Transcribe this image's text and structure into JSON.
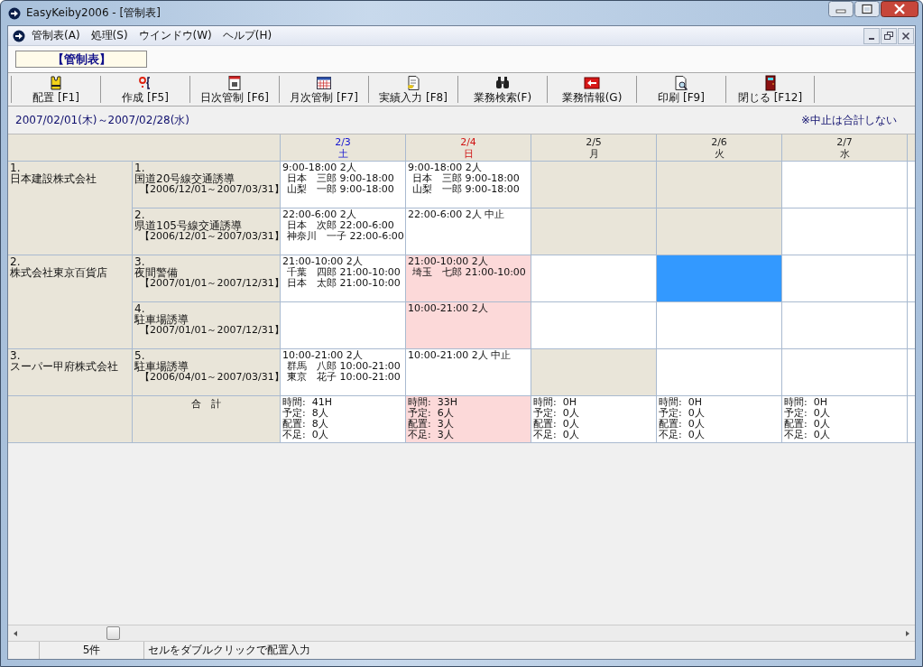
{
  "window": {
    "title": "EasyKeiby2006 - [管制表]"
  },
  "menu": [
    {
      "label": "管制表(A)"
    },
    {
      "label": "処理(S)"
    },
    {
      "label": "ウインドウ(W)"
    },
    {
      "label": "ヘルプ(H)"
    }
  ],
  "form_label": "【管制表】",
  "toolbar": [
    {
      "label": "配置 [F1]"
    },
    {
      "label": "作成 [F5]"
    },
    {
      "label": "日次管制 [F6]"
    },
    {
      "label": "月次管制 [F7]"
    },
    {
      "label": "実績入力 [F8]"
    },
    {
      "label": "業務検索(F)"
    },
    {
      "label": "業務情報(G)"
    },
    {
      "label": "印刷 [F9]"
    },
    {
      "label": "閉じる [F12]"
    }
  ],
  "period": "2007/02/01(木)～2007/02/28(水)",
  "note": "※中止は合計しない",
  "days": [
    {
      "date": "2/3",
      "weekday": "土",
      "kind": "saturday"
    },
    {
      "date": "2/4",
      "weekday": "日",
      "kind": "sunday"
    },
    {
      "date": "2/5",
      "weekday": "月",
      "kind": "weekday"
    },
    {
      "date": "2/6",
      "weekday": "火",
      "kind": "weekday"
    },
    {
      "date": "2/7",
      "weekday": "水",
      "kind": "weekday"
    }
  ],
  "companies": [
    {
      "number": "1.",
      "name": "日本建設株式会社",
      "jobs": [
        {
          "number": "1.",
          "name": "国道20号線交通誘導",
          "period": "【2006/12/01～2007/03/31】",
          "cells": [
            {
              "kind": "open",
              "selected": false,
              "shift": "9:00-18:00 2人",
              "staff": [
                "日本　三郎 9:00-18:00",
                "山梨　一郎 9:00-18:00"
              ]
            },
            {
              "kind": "open",
              "selected": false,
              "shift": "9:00-18:00 2人",
              "staff": [
                "日本　三郎 9:00-18:00",
                "山梨　一郎 9:00-18:00"
              ]
            },
            {
              "kind": "closed",
              "selected": false
            },
            {
              "kind": "closed",
              "selected": false
            },
            {
              "kind": "open",
              "selected": false
            }
          ]
        },
        {
          "number": "2.",
          "name": "県道105号線交通誘導",
          "period": "【2006/12/01～2007/03/31】",
          "cells": [
            {
              "kind": "open",
              "selected": false,
              "shift": "22:00-6:00 2人",
              "staff": [
                "日本　次郎 22:00-6:00",
                "神奈川　一子 22:00-6:00"
              ]
            },
            {
              "kind": "open",
              "selected": false,
              "shift": "22:00-6:00 2人 中止"
            },
            {
              "kind": "closed",
              "selected": false
            },
            {
              "kind": "closed",
              "selected": false
            },
            {
              "kind": "open",
              "selected": false
            }
          ]
        }
      ]
    },
    {
      "number": "2.",
      "name": "株式会社東京百貨店",
      "jobs": [
        {
          "number": "3.",
          "name": "夜間警備",
          "period": "【2007/01/01～2007/12/31】",
          "cells": [
            {
              "kind": "open",
              "selected": false,
              "shift": "21:00-10:00 2人",
              "staff": [
                "千葉　四郎 21:00-10:00",
                "日本　太郎 21:00-10:00"
              ]
            },
            {
              "kind": "short",
              "selected": false,
              "shift": "21:00-10:00 2人",
              "staff": [
                "埼玉　七郎 21:00-10:00"
              ]
            },
            {
              "kind": "open",
              "selected": false
            },
            {
              "kind": "open",
              "selected": true
            },
            {
              "kind": "open",
              "selected": false
            }
          ]
        },
        {
          "number": "4.",
          "name": "駐車場誘導",
          "period": "【2007/01/01～2007/12/31】",
          "cells": [
            {
              "kind": "open",
              "selected": false
            },
            {
              "kind": "short",
              "selected": false,
              "shift": "10:00-21:00 2人"
            },
            {
              "kind": "open",
              "selected": false
            },
            {
              "kind": "open",
              "selected": false
            },
            {
              "kind": "open",
              "selected": false
            }
          ]
        }
      ]
    },
    {
      "number": "3.",
      "name": "スーパー甲府株式会社",
      "jobs": [
        {
          "number": "5.",
          "name": "駐車場誘導",
          "period": "【2006/04/01～2007/03/31】",
          "cells": [
            {
              "kind": "open",
              "selected": false,
              "shift": "10:00-21:00 2人",
              "staff": [
                "群馬　八郎 10:00-21:00",
                "東京　花子 10:00-21:00"
              ]
            },
            {
              "kind": "open",
              "selected": false,
              "shift": "10:00-21:00 2人 中止"
            },
            {
              "kind": "closed",
              "selected": false
            },
            {
              "kind": "open",
              "selected": false
            },
            {
              "kind": "open",
              "selected": false
            }
          ]
        }
      ]
    }
  ],
  "totals": {
    "label": "合　計",
    "cells": [
      {
        "kind": "open",
        "lines": [
          "時間:  41H",
          "予定:  8人",
          "配置:  8人",
          "不足:  0人"
        ]
      },
      {
        "kind": "short",
        "lines": [
          "時間:  33H",
          "予定:  6人",
          "配置:  3人",
          "不足:  3人"
        ]
      },
      {
        "kind": "open",
        "lines": [
          "時間:  0H",
          "予定:  0人",
          "配置:  0人",
          "不足:  0人"
        ]
      },
      {
        "kind": "open",
        "lines": [
          "時間:  0H",
          "予定:  0人",
          "配置:  0人",
          "不足:  0人"
        ]
      },
      {
        "kind": "open",
        "lines": [
          "時間:  0H",
          "予定:  0人",
          "配置:  0人",
          "不足:  0人"
        ]
      }
    ]
  },
  "status_bar": {
    "count": "5件",
    "message": "セルをダブルクリックで配置入力"
  }
}
